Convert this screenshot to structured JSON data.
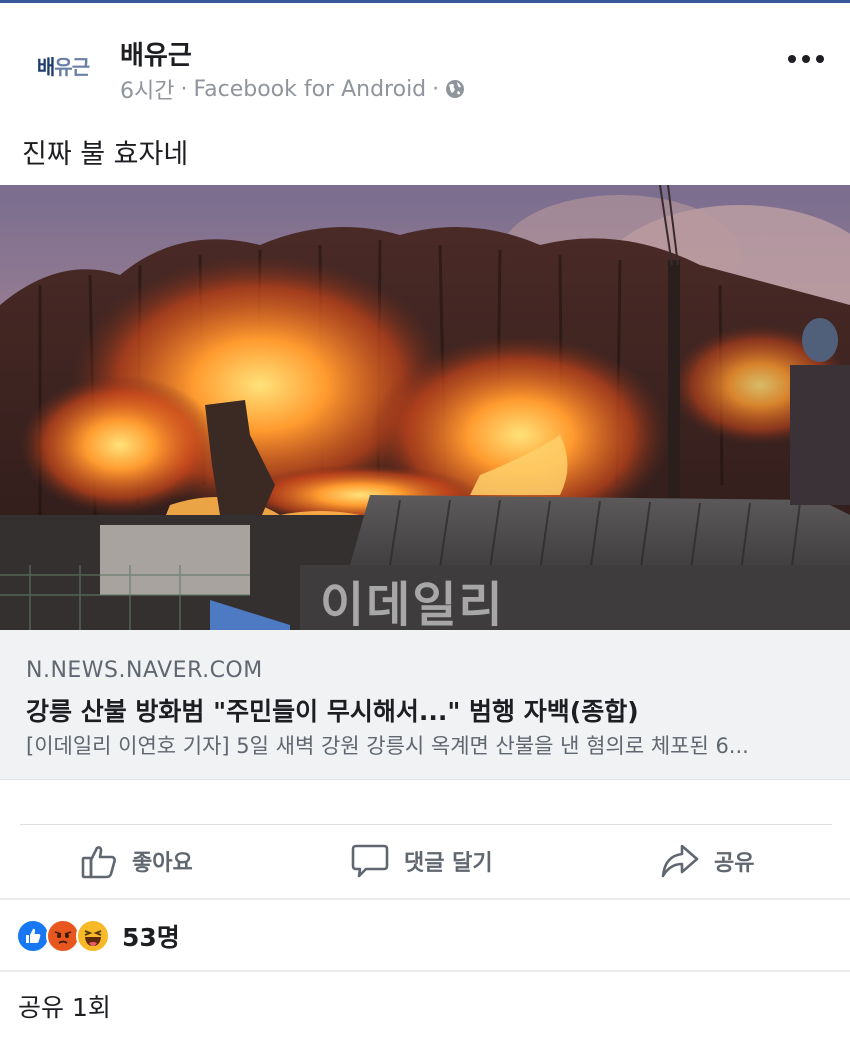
{
  "post": {
    "author_avatar_text_a": "배",
    "author_avatar_text_b": "유근",
    "author": "배유근",
    "time": "6시간",
    "separator": "·",
    "source_app": "Facebook for Android",
    "separator2": "·",
    "body_text": "진짜 불 효자네"
  },
  "link_preview": {
    "image_watermark": "이데일리",
    "domain": "N.NEWS.NAVER.COM",
    "title": "강릉 산불 방화범 \"주민들이 무시해서...\" 범행 자백(종합)",
    "description": "[이데일리 이연호 기자] 5일 새벽 강원 강릉시 옥계면 산불을 낸 혐의로 체포된 6..."
  },
  "actions": {
    "like_label": "좋아요",
    "comment_label": "댓글 달기",
    "share_label": "공유"
  },
  "reactions": {
    "icons": [
      "like-icon",
      "angry-icon",
      "haha-icon"
    ],
    "count": "53명"
  },
  "shares": {
    "text": "공유 1회"
  },
  "colors": {
    "brand": "#3b5998",
    "like": "#1877f2",
    "angry": "#e8581e",
    "haha": "#f7b928",
    "secondary_text": "#606770"
  }
}
